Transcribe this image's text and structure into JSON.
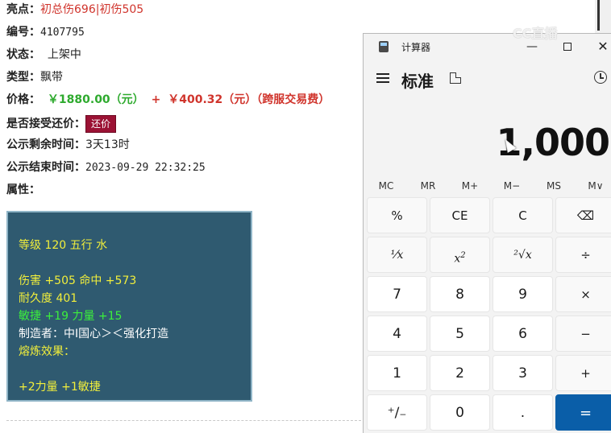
{
  "listing": {
    "highlights_label": "亮点：",
    "highlights_value": "初总伤696|初伤505",
    "id_label": "编号：",
    "id_value": "4107795",
    "status_label": "状态：",
    "status_value": "上架中",
    "type_label": "类型：",
    "type_value": "飘带",
    "price_label": "价格：",
    "price_value": "￥1880.00（元）",
    "price_plus": "+",
    "fee_value": "￥400.32（元）（跨服交易费）",
    "haggle_label": "是否接受还价：",
    "haggle_button": "还价",
    "remaining_label": "公示剩余时间：",
    "remaining_value": "3天13时",
    "end_label": "公示结束时间：",
    "end_value": "2023-09-29 22:32:25",
    "attr_label": "属性："
  },
  "attributes": {
    "line1": "等级 120 五行 水",
    "line2": "伤害 +505 命中 +573",
    "line3": "耐久度 401",
    "line4": "敏捷 +19 力量 +15",
    "line5": "制造者：中I国心＞＜强化打造",
    "line6": "熔炼效果：",
    "line7": "+2力量 +1敏捷"
  },
  "watermark": "CC直播",
  "calculator": {
    "window_title": "计算器",
    "minimize": "—",
    "close": "✕",
    "mode": "标准",
    "display": "1,000",
    "memory": [
      "MC",
      "MR",
      "M+",
      "M−",
      "MS",
      "M∨"
    ],
    "keys": {
      "percent": "%",
      "ce": "CE",
      "c": "C",
      "backspace": "⌫",
      "reciprocal": "⅟x",
      "square": "x",
      "square_sup": "2",
      "sqrt": "²√x",
      "divide": "÷",
      "seven": "7",
      "eight": "8",
      "nine": "9",
      "multiply": "×",
      "four": "4",
      "five": "5",
      "six": "6",
      "minus": "−",
      "one": "1",
      "two": "2",
      "three": "3",
      "plus": "+",
      "negate": "⁺∕₋",
      "zero": "0",
      "decimal": ".",
      "equals": "="
    }
  }
}
